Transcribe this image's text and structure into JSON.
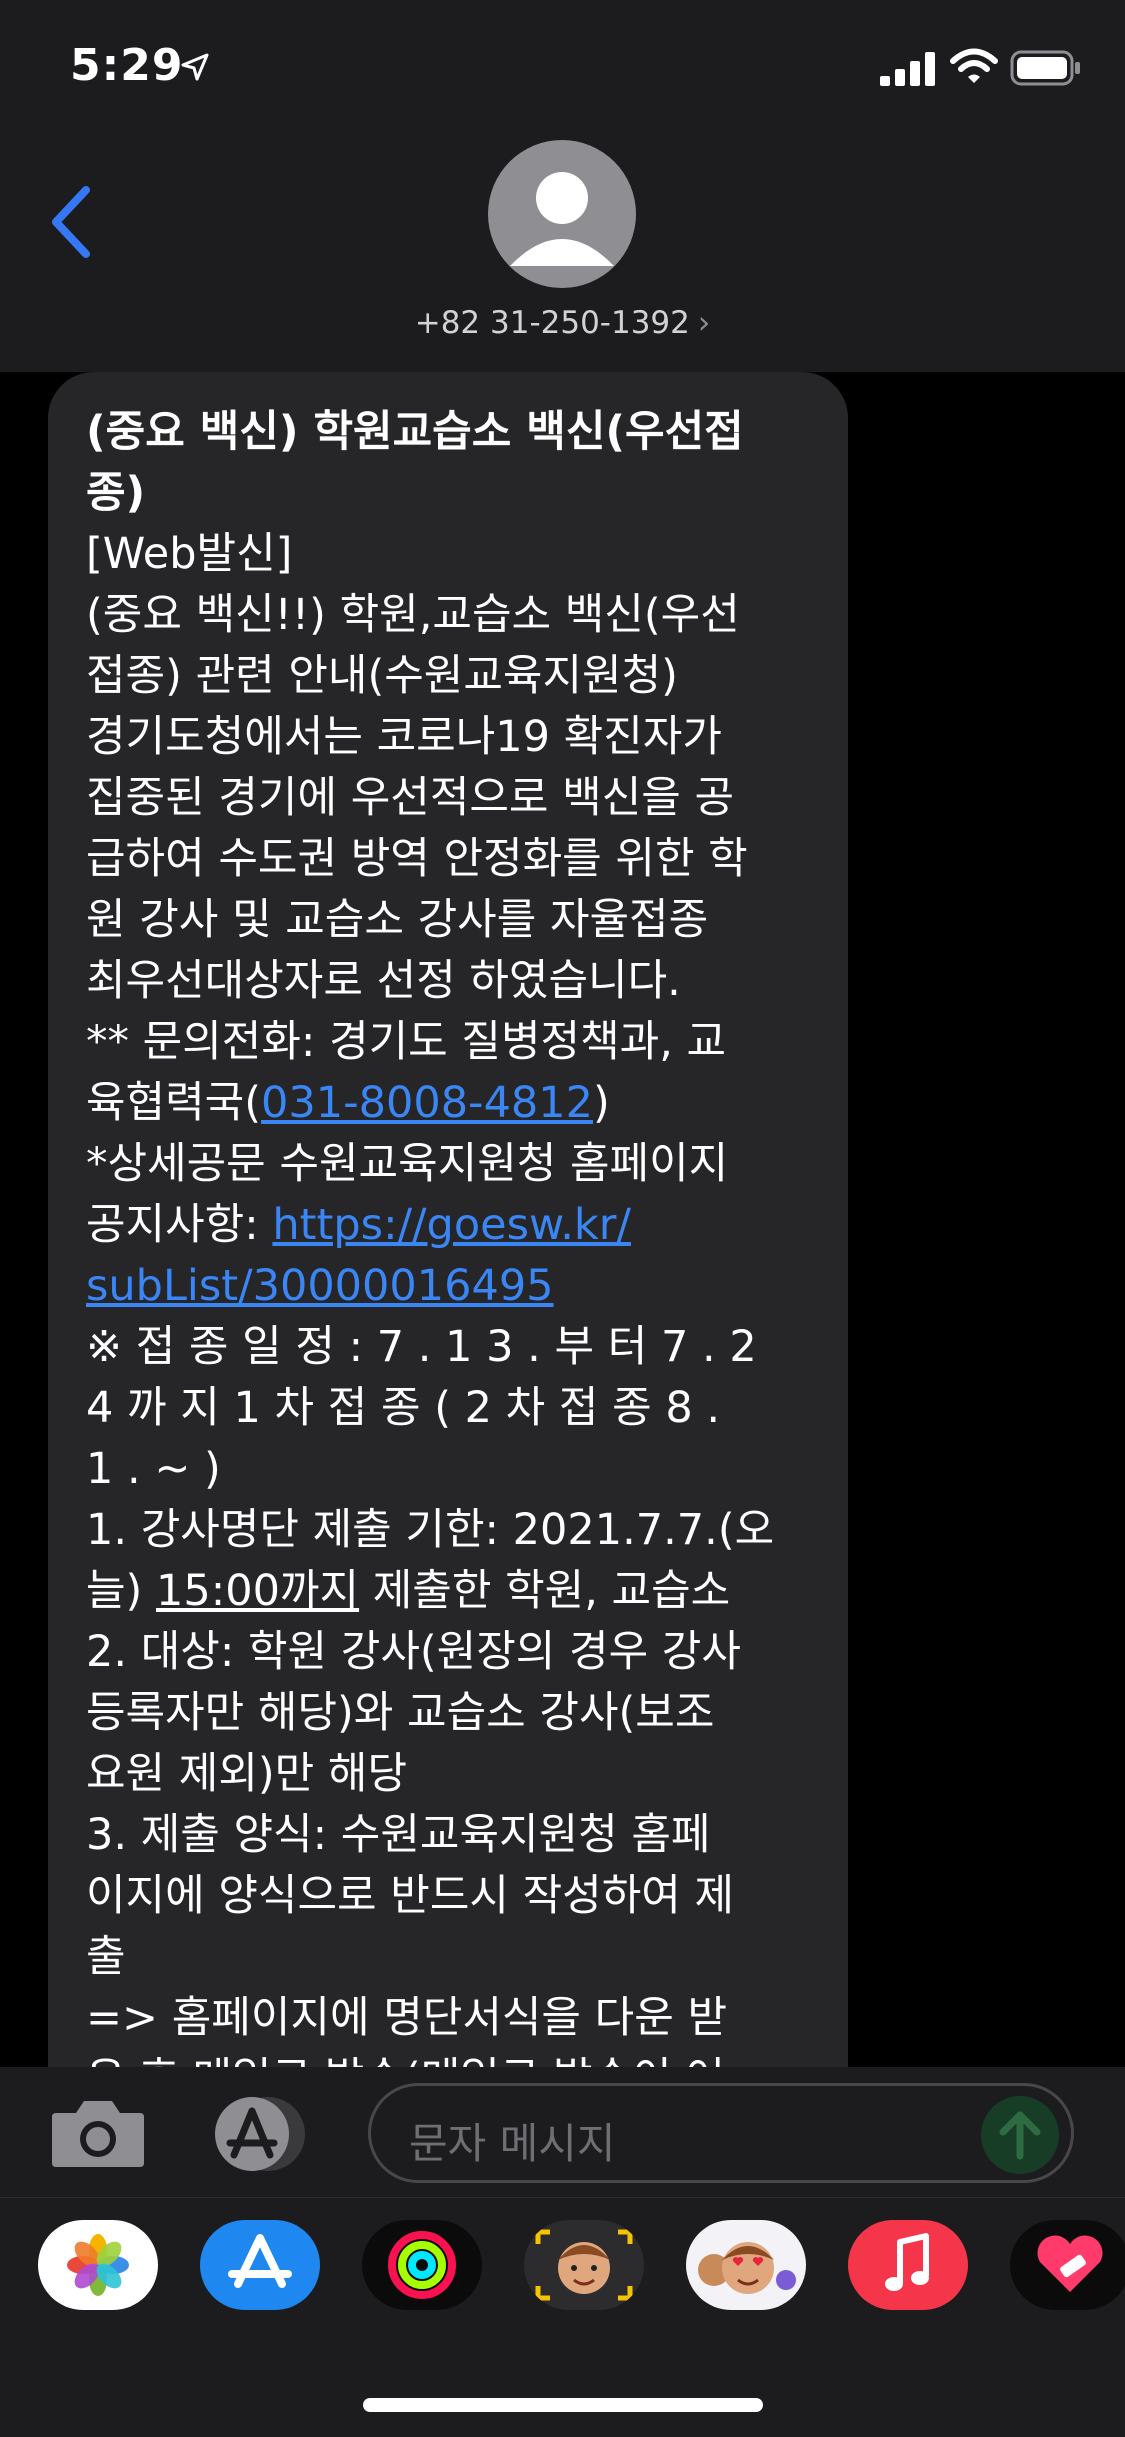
{
  "status_bar": {
    "time": "5:29"
  },
  "header": {
    "contact_number": "+82 31-250-1392",
    "chevron": "›"
  },
  "message": {
    "lines": [
      "(중요 백신) 학원교습소 백신(우선접",
      "종)",
      "[Web발신]",
      "(중요 백신!!) 학원,교습소 백신(우선",
      "접종) 관련 안내(수원교육지원청)",
      "경기도청에서는 코로나19 확진자가",
      "집중된 경기에 우선적으로 백신을 공",
      "급하여 수도권 방역 안정화를 위한 학",
      "원 강사 및 교습소 강사를 자율접종",
      "최우선대상자로 선정 하였습니다.",
      "** 문의전화: 경기도 질병정책과, 교",
      "육협력국(",
      "031-8008-4812",
      ")",
      "*상세공문 수원교육지원청 홈페이지",
      "공지사항: ",
      "https://goesw.kr/",
      "subList/30000016495",
      "※ 접 종 일 정 : 7 . 1 3 . 부 터 7 . 2",
      "4 까 지 1 차 접 종 ( 2 차 접 종 8 .",
      "1 . ~ )",
      " 1. 강사명단 제출 기한: 2021.7.7.(오",
      "늘) ",
      "15:00까지",
      " 제출한 학원, 교습소",
      " 2. 대상: 학원 강사(원장의 경우 강사",
      "등록자만 해당)와 교습소 강사(보조",
      "요원 제외)만 해당",
      " 3. 제출 양식: 수원교육지원청 홈페",
      "이지에 양식으로 반드시 작성하여 제",
      "출",
      "  => 홈페이지에 명단서식을 다운 받",
      "은 후 메일로 발송(메일로 발송이 어"
    ]
  },
  "input": {
    "placeholder": "문자 메시지"
  },
  "apps": [
    "photos-icon",
    "app-store-icon",
    "activity-icon",
    "memoji-icon",
    "memoji-stickers-icon",
    "music-icon",
    "health-icon"
  ],
  "colors": {
    "link": "#3a86f5",
    "bubble": "#262628",
    "accent": "#3478f6"
  }
}
